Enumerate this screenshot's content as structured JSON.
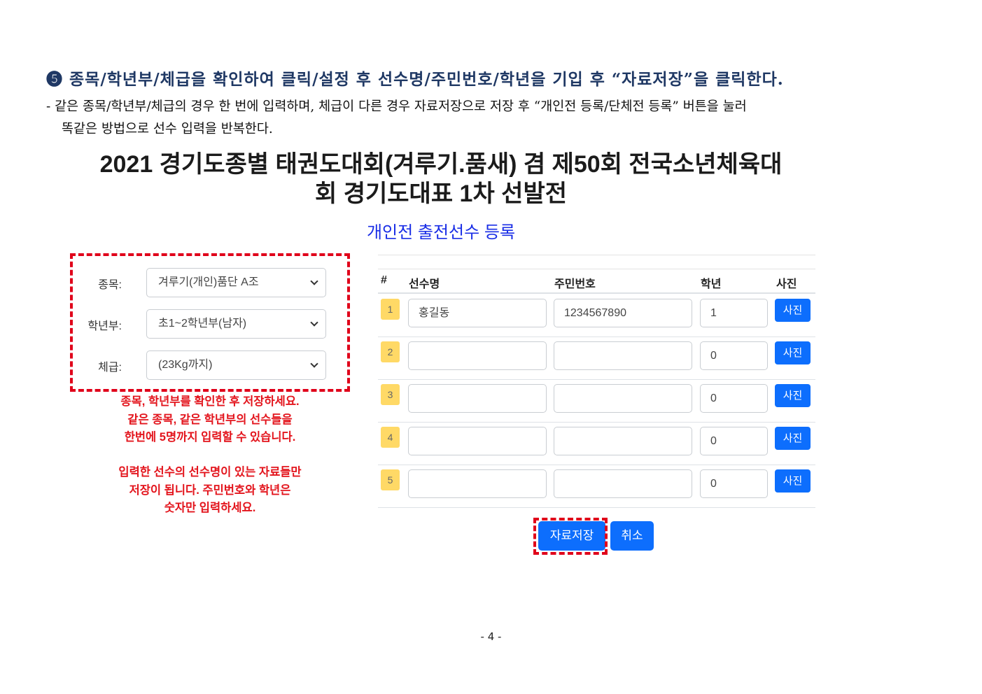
{
  "instructions": {
    "heading": "❺ 종목/학년부/체급을 확인하여 클릭/설정 후 선수명/주민번호/학년을 기입 후 “자료저장”을 클릭한다.",
    "note_line1": "- 같은 종목/학년부/체급의 경우 한 번에 입력하며, 체급이 다른 경우 자료저장으로 저장 후 “개인전 등록/단체전 등록” 버튼을 눌러",
    "note_line2": "똑같은 방법으로 선수 입력을 반복한다."
  },
  "page": {
    "title_line1": "2021 경기도종별 태권도대회(겨루기.품새) 겸 제50회 전국소년체육대",
    "title_line2": "회 경기도대표 1차 선발전",
    "subtitle": "개인전 출전선수 등록"
  },
  "form": {
    "event_label": "종목:",
    "event_value": "겨루기(개인)품단 A조",
    "division_label": "학년부:",
    "division_value": "초1~2학년부(남자)",
    "weight_label": "체급:",
    "weight_value": "(23Kg까지)"
  },
  "notice": {
    "line1": "종목, 학년부를 확인한 후 저장하세요.",
    "line2": "같은 종목, 같은 학년부의 선수들을",
    "line3": "한번에 5명까지 입력할 수 있습니다.",
    "line4": "입력한 선수의 선수명이 있는 자료들만",
    "line5": "저장이 됩니다. 주민번호와 학년은",
    "line6": "숫자만 입력하세요."
  },
  "table": {
    "headers": {
      "num": "#",
      "name": "선수명",
      "id": "주민번호",
      "grade": "학년",
      "photo": "사진"
    },
    "rows": [
      {
        "num": "1",
        "name": "홍길동",
        "id": "1234567890",
        "grade": "1",
        "photo": "사진"
      },
      {
        "num": "2",
        "name": "",
        "id": "",
        "grade": "0",
        "photo": "사진"
      },
      {
        "num": "3",
        "name": "",
        "id": "",
        "grade": "0",
        "photo": "사진"
      },
      {
        "num": "4",
        "name": "",
        "id": "",
        "grade": "0",
        "photo": "사진"
      },
      {
        "num": "5",
        "name": "",
        "id": "",
        "grade": "0",
        "photo": "사진"
      }
    ]
  },
  "actions": {
    "save_label": "자료저장",
    "cancel_label": "취소"
  },
  "footer": {
    "page_number": "- 4 -"
  },
  "colors": {
    "primary": "#0d6efd",
    "highlight": "#e0001a",
    "badge": "#ffd966",
    "subtitle": "#1a2ee6"
  }
}
